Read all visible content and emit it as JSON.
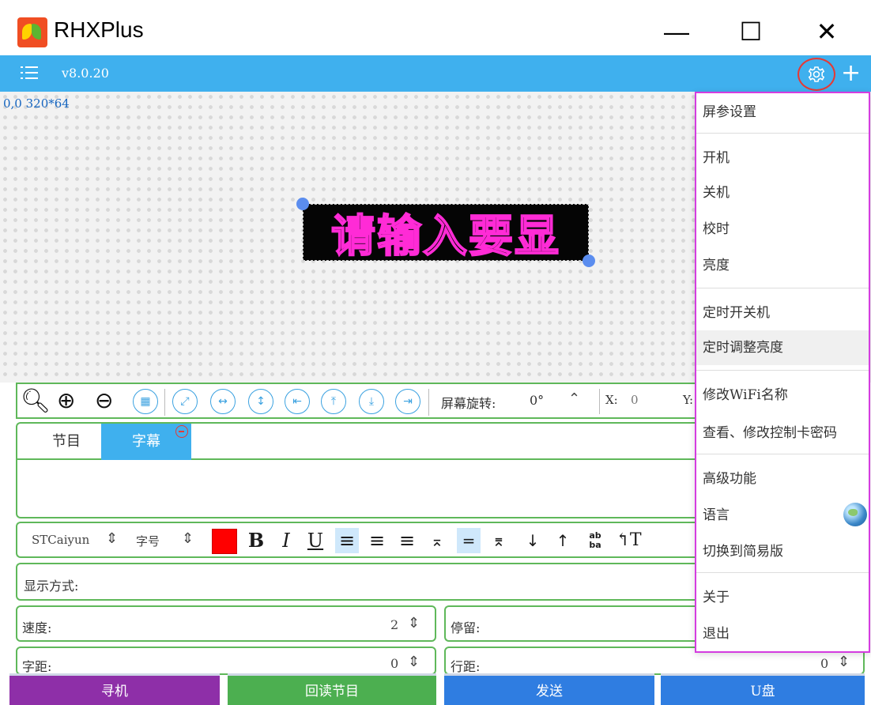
{
  "window": {
    "title": "RHXPlus",
    "minimize": "—",
    "maximize": "☐",
    "close": "✕"
  },
  "toolbar": {
    "version": "v8.0.20",
    "menu_icon": "list-icon",
    "settings_icon": "gear-icon",
    "add_label": "+"
  },
  "canvas": {
    "coords_text": "0,0 320*64",
    "preview_text": "请输入要显"
  },
  "edit_toolbar": {
    "rotate_label": "屏幕旋转:",
    "rotate_value": "0°",
    "x_label": "X:",
    "x_value": "0",
    "y_label": "Y:"
  },
  "tabs": [
    {
      "label": "节目",
      "active": false
    },
    {
      "label": "字幕",
      "active": true
    }
  ],
  "format": {
    "font_name": "STCaiyun",
    "font_size_label": "字号",
    "color": "#ff0000",
    "bold": "B",
    "italic": "I",
    "underline": "U",
    "wrap": "ab\nba",
    "text_dir": "↰T"
  },
  "display": {
    "label": "显示方式:"
  },
  "fields": {
    "speed_label": "速度:",
    "speed_value": "2",
    "stay_label": "停留:",
    "char_spacing_label": "字距:",
    "char_spacing_value": "0",
    "line_spacing_label": "行距:",
    "line_spacing_value": "0"
  },
  "bottom_buttons": [
    {
      "label": "寻机",
      "color": "#8e2fa8"
    },
    {
      "label": "回读节目",
      "color": "#4caf50"
    },
    {
      "label": "发送",
      "color": "#2f7de1"
    },
    {
      "label": "U盘",
      "color": "#2f7de1"
    }
  ],
  "menu": {
    "items": [
      "屏参设置",
      "开机",
      "关机",
      "校时",
      "亮度",
      "定时开关机",
      "定时调整亮度",
      "修改WiFi名称",
      "查看、修改控制卡密码",
      "高级功能",
      "语言",
      "切换到简易版",
      "关于",
      "退出"
    ],
    "language_icon": "globe-icon"
  }
}
